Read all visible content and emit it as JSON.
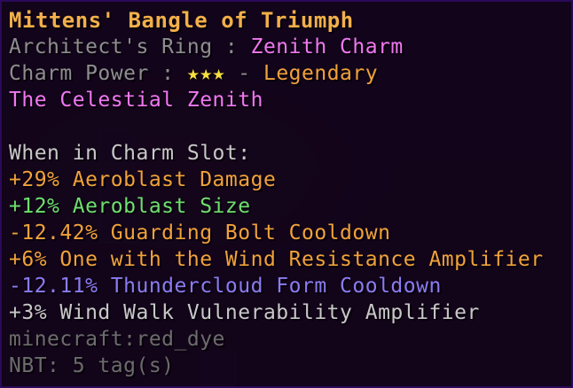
{
  "tooltip": {
    "title": "Mittens' Bangle of Triumph",
    "ring_label": "Architect's Ring : ",
    "ring_value": "Zenith Charm",
    "power_label": "Charm Power : ",
    "power_stars": "★★★",
    "power_sep": " - ",
    "power_value": "Legendary",
    "set_name": "The Celestial Zenith",
    "slot_heading": "When in Charm Slot:",
    "effects": [
      {
        "text": "+29% Aeroblast Damage",
        "color": "#f0a23a"
      },
      {
        "text": "+12% Aeroblast Size",
        "color": "#6ee06e"
      },
      {
        "text": "-12.42% Guarding Bolt Cooldown",
        "color": "#f0a23a"
      },
      {
        "text": "+6% One with the Wind Resistance Amplifier",
        "color": "#f0a23a"
      },
      {
        "text": "-12.11% Thundercloud Form Cooldown",
        "color": "#8a7cf0"
      },
      {
        "text": "+3% Wind Walk Vulnerability Amplifier",
        "color": "#c8c8c8"
      }
    ],
    "item_id": "minecraft:red_dye",
    "nbt": "NBT: 5 tag(s)"
  },
  "colors": {
    "title": "#f2b04a",
    "label_gray": "#8e8e8e",
    "pink": "#f078f0",
    "star": "#f8e040",
    "legendary": "#f0a23a"
  }
}
